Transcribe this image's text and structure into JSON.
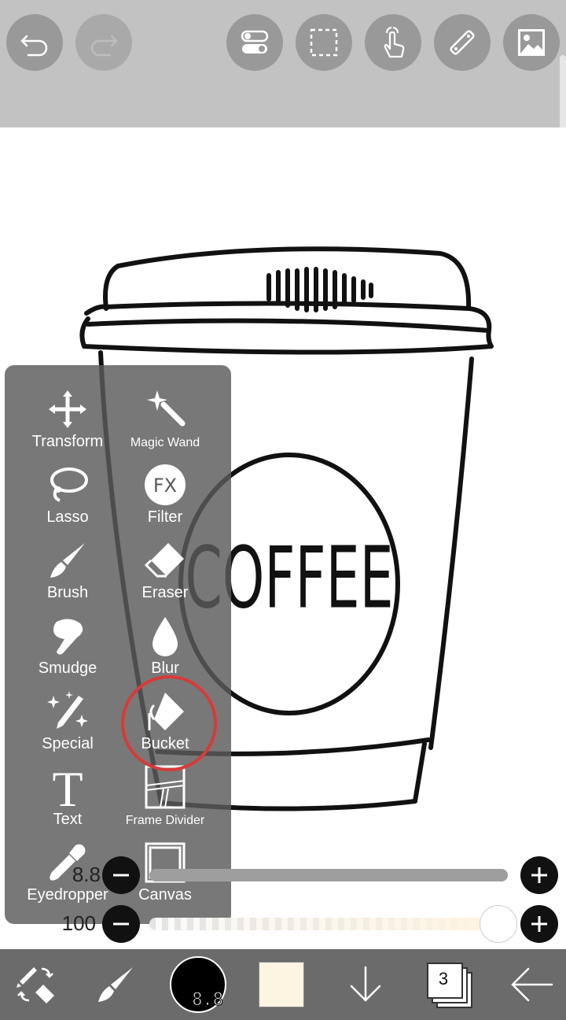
{
  "toolbar": {
    "undo": "undo-icon",
    "redo": "redo-icon",
    "toggles": "toggle-switches-icon",
    "selection": "selection-icon",
    "gesture": "gesture-icon",
    "ruler": "ruler-icon",
    "image": "image-icon"
  },
  "canvas": {
    "cup_text": "COFFEE"
  },
  "tools": [
    {
      "label": "Transform",
      "icon": "transform-icon"
    },
    {
      "label": "Magic Wand",
      "icon": "magic-wand-icon"
    },
    {
      "label": "Lasso",
      "icon": "lasso-icon"
    },
    {
      "label": "Filter",
      "icon": "filter-icon",
      "icon_text": "FX"
    },
    {
      "label": "Brush",
      "icon": "brush-icon"
    },
    {
      "label": "Eraser",
      "icon": "eraser-icon"
    },
    {
      "label": "Smudge",
      "icon": "smudge-icon"
    },
    {
      "label": "Blur",
      "icon": "blur-icon"
    },
    {
      "label": "Special",
      "icon": "special-icon"
    },
    {
      "label": "Bucket",
      "icon": "bucket-icon",
      "highlighted": true
    },
    {
      "label": "Text",
      "icon": "text-icon",
      "icon_text": "T"
    },
    {
      "label": "Frame Divider",
      "icon": "frame-divider-icon"
    },
    {
      "label": "Eyedropper",
      "icon": "eyedropper-icon"
    },
    {
      "label": "Canvas",
      "icon": "canvas-icon"
    }
  ],
  "sliders": {
    "size": {
      "value": "8.8",
      "fraction": 0.02
    },
    "opacity": {
      "value": "100",
      "fraction": 1.0
    }
  },
  "bottom": {
    "brush_size": "8.8",
    "primary_color": "#000000",
    "secondary_color": "#fef4e2",
    "layer_count": "3",
    "icons": [
      "swap-tools-icon",
      "brush-icon",
      "color-icon",
      "secondary-color-icon",
      "move-down-icon",
      "layers-icon",
      "back-icon"
    ]
  }
}
